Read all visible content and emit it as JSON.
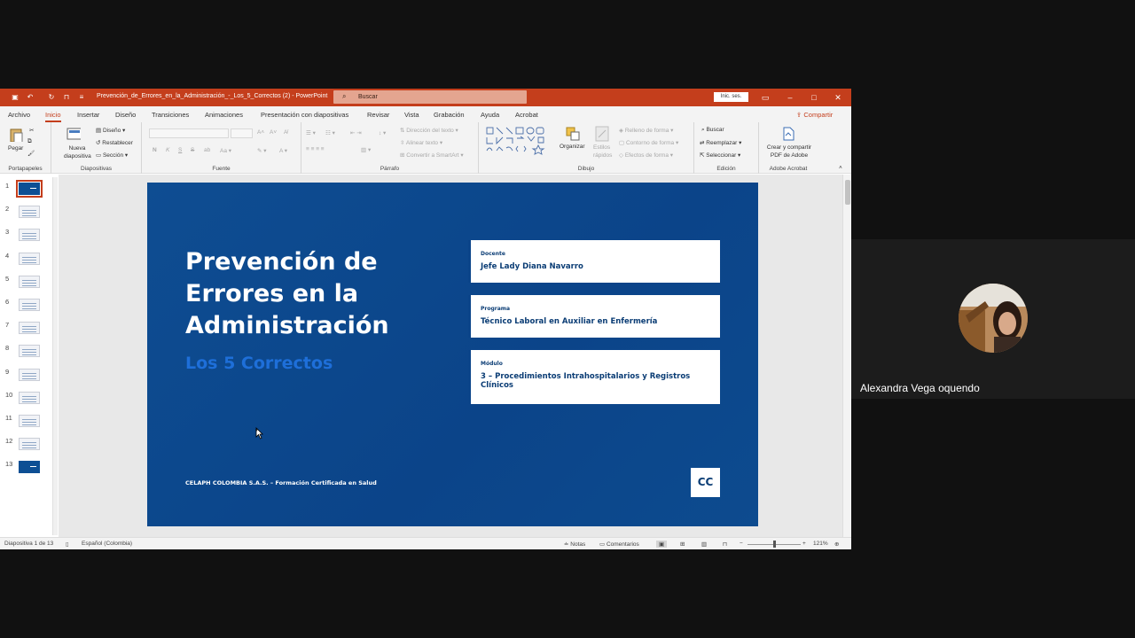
{
  "titlebar": {
    "document_title": "Prevención_de_Errores_en_la_Administración_-_Los_5_Correctos (2) - PowerPoint",
    "search_placeholder": "Buscar",
    "signin": "Inic. ses.",
    "accent": "#c43e1c"
  },
  "menu": {
    "tabs": [
      "Archivo",
      "Inicio",
      "Insertar",
      "Diseño",
      "Transiciones",
      "Animaciones",
      "Presentación con diapositivas",
      "Revisar",
      "Vista",
      "Grabación",
      "Ayuda",
      "Acrobat"
    ],
    "active": "Inicio",
    "share": "Compartir"
  },
  "ribbon": {
    "clipboard": {
      "paste": "Pegar",
      "label": "Portapapeles"
    },
    "slides": {
      "new_slide": "Nueva diapositiva",
      "layout": "Diseño",
      "reset": "Restablecer",
      "section": "Sección",
      "label": "Diapositivas"
    },
    "font": {
      "label": "Fuente",
      "bold": "N",
      "italic": "K",
      "underline": "S",
      "strike": "S"
    },
    "paragraph": {
      "label": "Párrafo",
      "text_direction": "Dirección del texto",
      "align_text": "Alinear texto",
      "smartart": "Convertir a SmartArt"
    },
    "drawing": {
      "label": "Dibujo",
      "arrange": "Organizar",
      "quick_styles": "Estilos rápidos",
      "shape_fill": "Relleno de forma",
      "shape_outline": "Contorno de forma",
      "shape_effects": "Efectos de forma"
    },
    "editing": {
      "label": "Edición",
      "find": "Buscar",
      "replace": "Reemplazar",
      "select": "Seleccionar"
    },
    "acrobat": {
      "label": "Adobe Acrobat",
      "create": "Crear y compartir PDF de Adobe"
    }
  },
  "thumbnails": [
    "1",
    "2",
    "3",
    "4",
    "5",
    "6",
    "7",
    "8",
    "9",
    "10",
    "11",
    "12",
    "13"
  ],
  "slide": {
    "title": "Prevención de Errores en la Administración",
    "subtitle": "Los 5 Correctos",
    "cards": [
      {
        "label": "Docente",
        "value": "Jefe Lady Diana Navarro"
      },
      {
        "label": "Programa",
        "value": "Técnico Laboral en Auxiliar en Enfermería"
      },
      {
        "label": "Módulo",
        "value": "3 – Procedimientos Intrahospitalarios y Registros Clínicos"
      }
    ],
    "footer": "CELAPH COLOMBIA S.A.S. – Formación Certificada en Salud",
    "logo": "CC",
    "background": "#0b4489",
    "subtitle_color": "#1e6fd9"
  },
  "status": {
    "slide_counter": "Diapositiva 1 de 13",
    "language": "Español (Colombia)",
    "notes": "Notas",
    "comments": "Comentarios",
    "zoom": "121%"
  },
  "participant": {
    "name": "Alexandra Vega oquendo"
  }
}
